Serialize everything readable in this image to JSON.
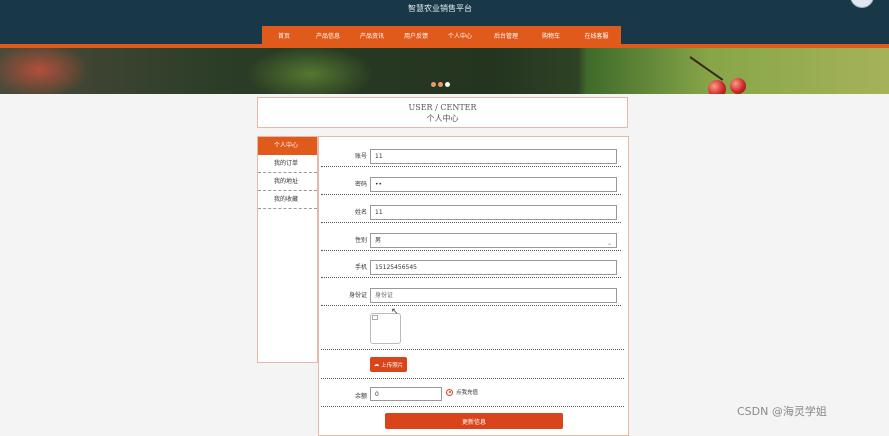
{
  "header": {
    "site_title": "智慧农业销售平台"
  },
  "nav": {
    "items": [
      {
        "label": "首页"
      },
      {
        "label": "产品信息"
      },
      {
        "label": "产品资讯"
      },
      {
        "label": "用户反馈"
      },
      {
        "label": "个人中心"
      },
      {
        "label": "后台管理"
      },
      {
        "label": "购物车"
      },
      {
        "label": "在线客服"
      }
    ],
    "accent_color": "#e05a1c"
  },
  "banner": {
    "slide_count": 3,
    "active_slide": 3
  },
  "page_title": {
    "en": "USER / CENTER",
    "cn": "个人中心"
  },
  "sidebar": {
    "items": [
      {
        "label": "个人中心",
        "active": true
      },
      {
        "label": "我的订单",
        "active": false
      },
      {
        "label": "我的地址",
        "active": false
      },
      {
        "label": "我的收藏",
        "active": false
      }
    ]
  },
  "form": {
    "account": {
      "label": "账号",
      "value": "11"
    },
    "password": {
      "label": "密码",
      "value": "••"
    },
    "name": {
      "label": "姓名",
      "value": "11"
    },
    "gender": {
      "label": "性别",
      "value": "男"
    },
    "phone": {
      "label": "手机",
      "value": "15125456545"
    },
    "id_card": {
      "label": "身份证",
      "value": "",
      "placeholder": "身份证"
    },
    "upload_button": "上传照片",
    "balance": {
      "label": "余额",
      "value": "0"
    },
    "recharge_label": "点我充值",
    "update_button": "更新信息"
  },
  "watermark": "CSDN @海灵学姐"
}
